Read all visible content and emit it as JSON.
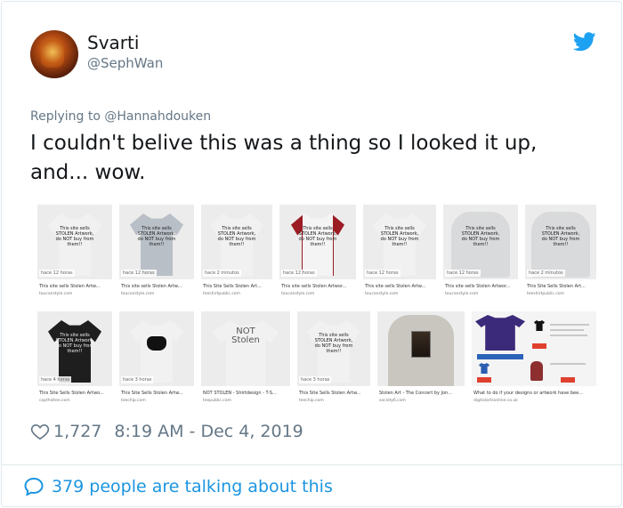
{
  "user": {
    "name": "Svarti",
    "handle": "@SephWan"
  },
  "reply": {
    "prefix": "Replying to",
    "mention": "@Hannahdouken"
  },
  "tweet": {
    "text": "I couldn't belive this was a thing so I looked it up, and... wow."
  },
  "search_results": {
    "row1": [
      {
        "badge": "hace 12 horas",
        "title": "This site sells Stolen Artw...",
        "source": "toucanstyle.com",
        "print": "This site sells STOLEN Artwork, do NOT buy from them!!"
      },
      {
        "badge": "hace 12 horas",
        "title": "This site sells Stolen Artw...",
        "source": "toucanstyle.com",
        "print": "This site sells STOLEN Artwork, do NOT buy from them!!"
      },
      {
        "badge": "hace 2 minutos",
        "title": "This Site Sells Stolen Art...",
        "source": "teeshirtpublic.com",
        "print": "This site sells STOLEN Artwork, do NOT buy from them!!"
      },
      {
        "badge": "hace 12 horas",
        "title": "This site sells Stolen Artwor...",
        "source": "toucanstyle.com",
        "print": "This site sells STOLEN Artwork, do NOT buy from them!!"
      },
      {
        "badge": "hace 12 horas",
        "title": "This site sells Stolen Artw...",
        "source": "toucanstyle.com",
        "print": "This site sells STOLEN Artwork, do NOT buy from them!!"
      },
      {
        "badge": "hace 12 horas",
        "title": "This site sells Stolen Artwor...",
        "source": "toucanstyle.com",
        "print": "This site sells STOLEN Artwork, do NOT buy from them!!"
      },
      {
        "badge": "hace 2 minutos",
        "title": "This Site Sells Stolen Art...",
        "source": "teeshirtpublic.com",
        "print": "This site sells STOLEN Artwork, do NOT buy from them!!"
      }
    ],
    "row2": [
      {
        "badge": "hace 4 horas",
        "title": "This Site Sells Stolen Artwo...",
        "source": "copthistee.com",
        "print": "This site sells STOLEN Artwork, do NOT buy from them!!"
      },
      {
        "badge": "hace 3 horas",
        "title": "This Site Sells Stolen Artw...",
        "source": "teechip.com",
        "print": ""
      },
      {
        "badge": "",
        "title": "NOT STOLEN - Shirtdesign - T-S...",
        "source": "teepublic.com",
        "print": "NOT Stolen"
      },
      {
        "badge": "hace 3 horas",
        "title": "This Site Sells Stolen Artw...",
        "source": "teechip.com",
        "print": "This site sells STOLEN Artwork, do NOT buy from them!!"
      },
      {
        "badge": "",
        "title": "Stolen Art - The Concert by Jon...",
        "source": "society6.com",
        "print": ""
      },
      {
        "badge": "",
        "title": "What to do if your designs or artwork have bee...",
        "source": "digitalartsonline.co.uk",
        "print": ""
      }
    ]
  },
  "stats": {
    "likes": "1,727",
    "timestamp": "8:19 AM - Dec 4, 2019"
  },
  "footer": {
    "talking": "379 people are talking about this"
  },
  "colors": {
    "twitter_blue": "#1da1f2",
    "link_blue": "#1b95e0",
    "muted": "#657786"
  }
}
